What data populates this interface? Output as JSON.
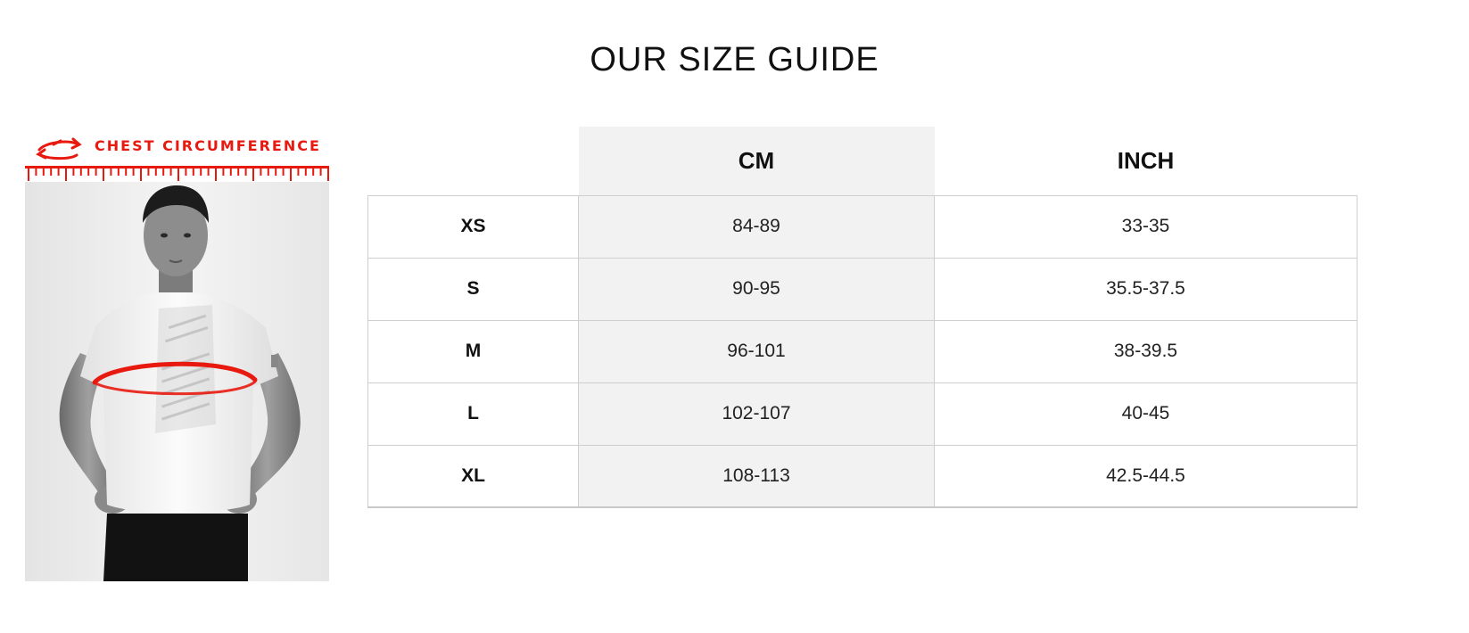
{
  "page": {
    "title": "OUR SIZE GUIDE"
  },
  "illustration": {
    "label": "CHEST CIRCUMFERENCE",
    "accent_color": "#e8190f",
    "icons": [
      "rotate-arrows-icon",
      "ruler-icon",
      "model-figure",
      "measure-band-icon"
    ]
  },
  "table": {
    "headers": {
      "size": "",
      "cm": "CM",
      "inch": "INCH"
    },
    "rows": [
      {
        "size": "XS",
        "cm": "84-89",
        "inch": "33-35"
      },
      {
        "size": "S",
        "cm": "90-95",
        "inch": "35.5-37.5"
      },
      {
        "size": "M",
        "cm": "96-101",
        "inch": "38-39.5"
      },
      {
        "size": "L",
        "cm": "102-107",
        "inch": "40-45"
      },
      {
        "size": "XL",
        "cm": "108-113",
        "inch": "42.5-44.5"
      }
    ],
    "colors": {
      "cm_column_bg": "#f2f2f2",
      "border": "#cfcfcf"
    }
  }
}
